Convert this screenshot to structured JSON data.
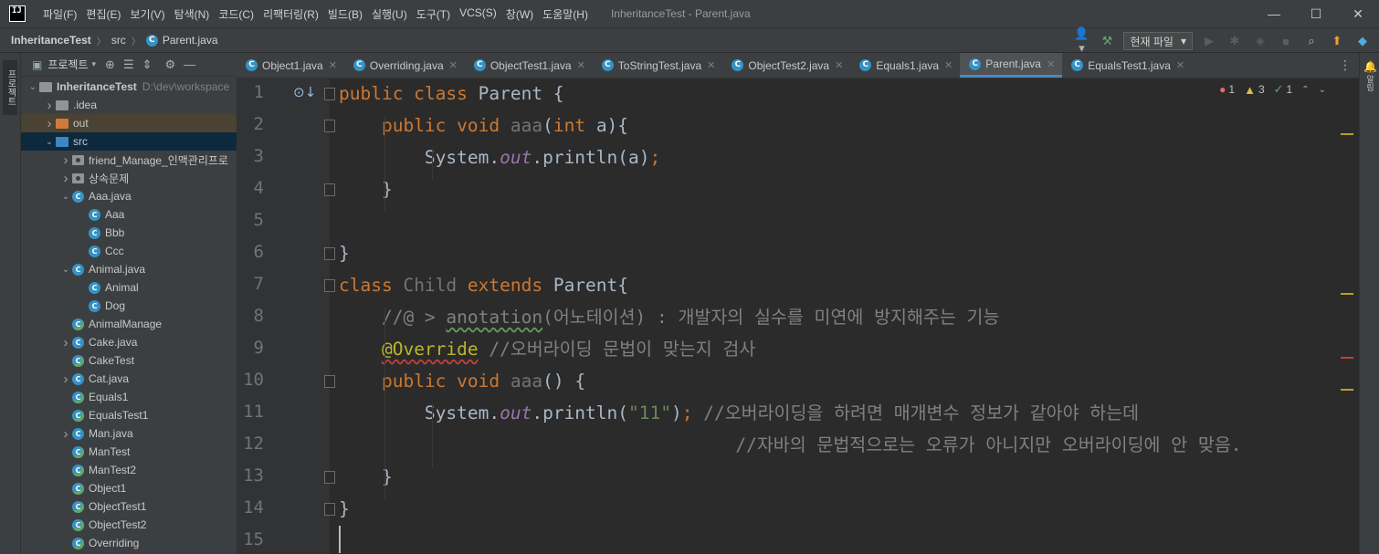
{
  "app": {
    "logo_text": "IJ",
    "window_title": "InheritanceTest - Parent.java"
  },
  "menu": [
    "파일(F)",
    "편집(E)",
    "보기(V)",
    "탐색(N)",
    "코드(C)",
    "리팩터링(R)",
    "빌드(B)",
    "실행(U)",
    "도구(T)",
    "VCS(S)",
    "창(W)",
    "도움말(H)"
  ],
  "window_controls": {
    "minimize": "—",
    "maximize": "☐",
    "close": "✕"
  },
  "breadcrumb": {
    "project": "InheritanceTest",
    "folder": "src",
    "file": "Parent.java"
  },
  "toolbar": {
    "run_config": "현재 파일",
    "icons": [
      "user-icon",
      "build-hammer-icon",
      "run-icon",
      "debug-icon",
      "coverage-icon",
      "stop-icon",
      "search-icon",
      "update-icon",
      "toolbox-icon"
    ]
  },
  "tool_strip": {
    "project_label": "프로젝트",
    "notifications_label": "알림"
  },
  "project_panel": {
    "title": "프로젝트",
    "tree": [
      {
        "label": "InheritanceTest",
        "path": "D:\\dev\\workspace",
        "type": "module",
        "depth": 0,
        "arrow": "v"
      },
      {
        "label": ".idea",
        "type": "folder-gray",
        "depth": 1,
        "arrow": ">"
      },
      {
        "label": "out",
        "type": "folder-orange",
        "depth": 1,
        "arrow": ">",
        "selected": "warm"
      },
      {
        "label": "src",
        "type": "folder-blue",
        "depth": 1,
        "arrow": "v",
        "selected": "dark"
      },
      {
        "label": "friend_Manage_인맥관리프로",
        "type": "package",
        "depth": 2,
        "arrow": ">"
      },
      {
        "label": "상속문제",
        "type": "package",
        "depth": 2,
        "arrow": ">"
      },
      {
        "label": "Aaa.java",
        "type": "class-file",
        "depth": 2,
        "arrow": "v"
      },
      {
        "label": "Aaa",
        "type": "class",
        "depth": 3,
        "arrow": ""
      },
      {
        "label": "Bbb",
        "type": "class",
        "depth": 3,
        "arrow": ""
      },
      {
        "label": "Ccc",
        "type": "class",
        "depth": 3,
        "arrow": ""
      },
      {
        "label": "Animal.java",
        "type": "class-file",
        "depth": 2,
        "arrow": "v"
      },
      {
        "label": "Animal",
        "type": "class",
        "depth": 3,
        "arrow": ""
      },
      {
        "label": "Dog",
        "type": "class",
        "depth": 3,
        "arrow": ""
      },
      {
        "label": "AnimalManage",
        "type": "runnable",
        "depth": 2,
        "arrow": ""
      },
      {
        "label": "Cake.java",
        "type": "class-file",
        "depth": 2,
        "arrow": ">"
      },
      {
        "label": "CakeTest",
        "type": "runnable",
        "depth": 2,
        "arrow": ""
      },
      {
        "label": "Cat.java",
        "type": "class-file",
        "depth": 2,
        "arrow": ">"
      },
      {
        "label": "Equals1",
        "type": "runnable",
        "depth": 2,
        "arrow": ""
      },
      {
        "label": "EqualsTest1",
        "type": "runnable",
        "depth": 2,
        "arrow": ""
      },
      {
        "label": "Man.java",
        "type": "class-file",
        "depth": 2,
        "arrow": ">"
      },
      {
        "label": "ManTest",
        "type": "runnable",
        "depth": 2,
        "arrow": ""
      },
      {
        "label": "ManTest2",
        "type": "runnable",
        "depth": 2,
        "arrow": ""
      },
      {
        "label": "Object1",
        "type": "runnable",
        "depth": 2,
        "arrow": ""
      },
      {
        "label": "ObjectTest1",
        "type": "runnable",
        "depth": 2,
        "arrow": ""
      },
      {
        "label": "ObjectTest2",
        "type": "runnable",
        "depth": 2,
        "arrow": ""
      },
      {
        "label": "Overriding",
        "type": "runnable",
        "depth": 2,
        "arrow": ""
      }
    ]
  },
  "tabs": [
    {
      "label": "Object1.java",
      "active": false
    },
    {
      "label": "Overriding.java",
      "active": false
    },
    {
      "label": "ObjectTest1.java",
      "active": false
    },
    {
      "label": "ToStringTest.java",
      "active": false
    },
    {
      "label": "ObjectTest2.java",
      "active": false
    },
    {
      "label": "Equals1.java",
      "active": false
    },
    {
      "label": "Parent.java",
      "active": true
    },
    {
      "label": "EqualsTest1.java",
      "active": false
    }
  ],
  "inspections": {
    "errors": "1",
    "warnings": "3",
    "weak_warnings": "1"
  },
  "editor": {
    "line_numbers": [
      "1",
      "2",
      "3",
      "4",
      "5",
      "6",
      "7",
      "8",
      "9",
      "10",
      "11",
      "12",
      "13",
      "14",
      "15"
    ],
    "lines": [
      [
        {
          "t": "public class ",
          "c": "kw"
        },
        {
          "t": "Parent {",
          "c": ""
        }
      ],
      [
        {
          "t": "    ",
          "c": ""
        },
        {
          "t": "public void ",
          "c": "kw"
        },
        {
          "t": "aaa",
          "c": "unused"
        },
        {
          "t": "(",
          "c": ""
        },
        {
          "t": "int ",
          "c": "kw"
        },
        {
          "t": "a){",
          "c": ""
        }
      ],
      [
        {
          "t": "        System.",
          "c": ""
        },
        {
          "t": "out",
          "c": "fld"
        },
        {
          "t": ".println(a)",
          "c": ""
        },
        {
          "t": ";",
          "c": "semi"
        }
      ],
      [
        {
          "t": "    }",
          "c": ""
        }
      ],
      [],
      [
        {
          "t": "}",
          "c": ""
        }
      ],
      [
        {
          "t": "class ",
          "c": "kw"
        },
        {
          "t": "Child ",
          "c": "unused"
        },
        {
          "t": "extends ",
          "c": "kw"
        },
        {
          "t": "Parent{",
          "c": ""
        }
      ],
      [
        {
          "t": "    //@ > ",
          "c": "cmt"
        },
        {
          "t": "anotation",
          "c": "cmt typo"
        },
        {
          "t": "(어노테이션) : 개발자의 실수를 미연에 방지해주는 기능",
          "c": "cmt"
        }
      ],
      [
        {
          "t": "    ",
          "c": ""
        },
        {
          "t": "@Override",
          "c": "ann"
        },
        {
          "t": " //오버라이딩 문법이 맞는지 검사",
          "c": "cmt"
        }
      ],
      [
        {
          "t": "    ",
          "c": ""
        },
        {
          "t": "public void ",
          "c": "kw"
        },
        {
          "t": "aaa",
          "c": "unused"
        },
        {
          "t": "() {",
          "c": ""
        }
      ],
      [
        {
          "t": "        System.",
          "c": ""
        },
        {
          "t": "out",
          "c": "fld"
        },
        {
          "t": ".println(",
          "c": ""
        },
        {
          "t": "\"11\"",
          "c": "str"
        },
        {
          "t": ")",
          "c": ""
        },
        {
          "t": ";",
          "c": "semi"
        },
        {
          "t": " //오버라이딩을 하려면 매개변수 정보가 같아야 하는데",
          "c": "cmt"
        }
      ],
      [
        {
          "t": "                                     //자바의 문법적으로는 오류가 아니지만 오버라이딩에 안 맞음.",
          "c": "cmt"
        }
      ],
      [
        {
          "t": "    }",
          "c": ""
        }
      ],
      [
        {
          "t": "}",
          "c": ""
        }
      ],
      []
    ]
  },
  "colors": {
    "background": "#2b2b2b",
    "gutter": "#313335",
    "keyword": "#cc7832",
    "comment": "#808080",
    "string": "#6a8759",
    "annotation": "#bbb529",
    "field": "#9876aa",
    "accent": "#4a88c7"
  }
}
